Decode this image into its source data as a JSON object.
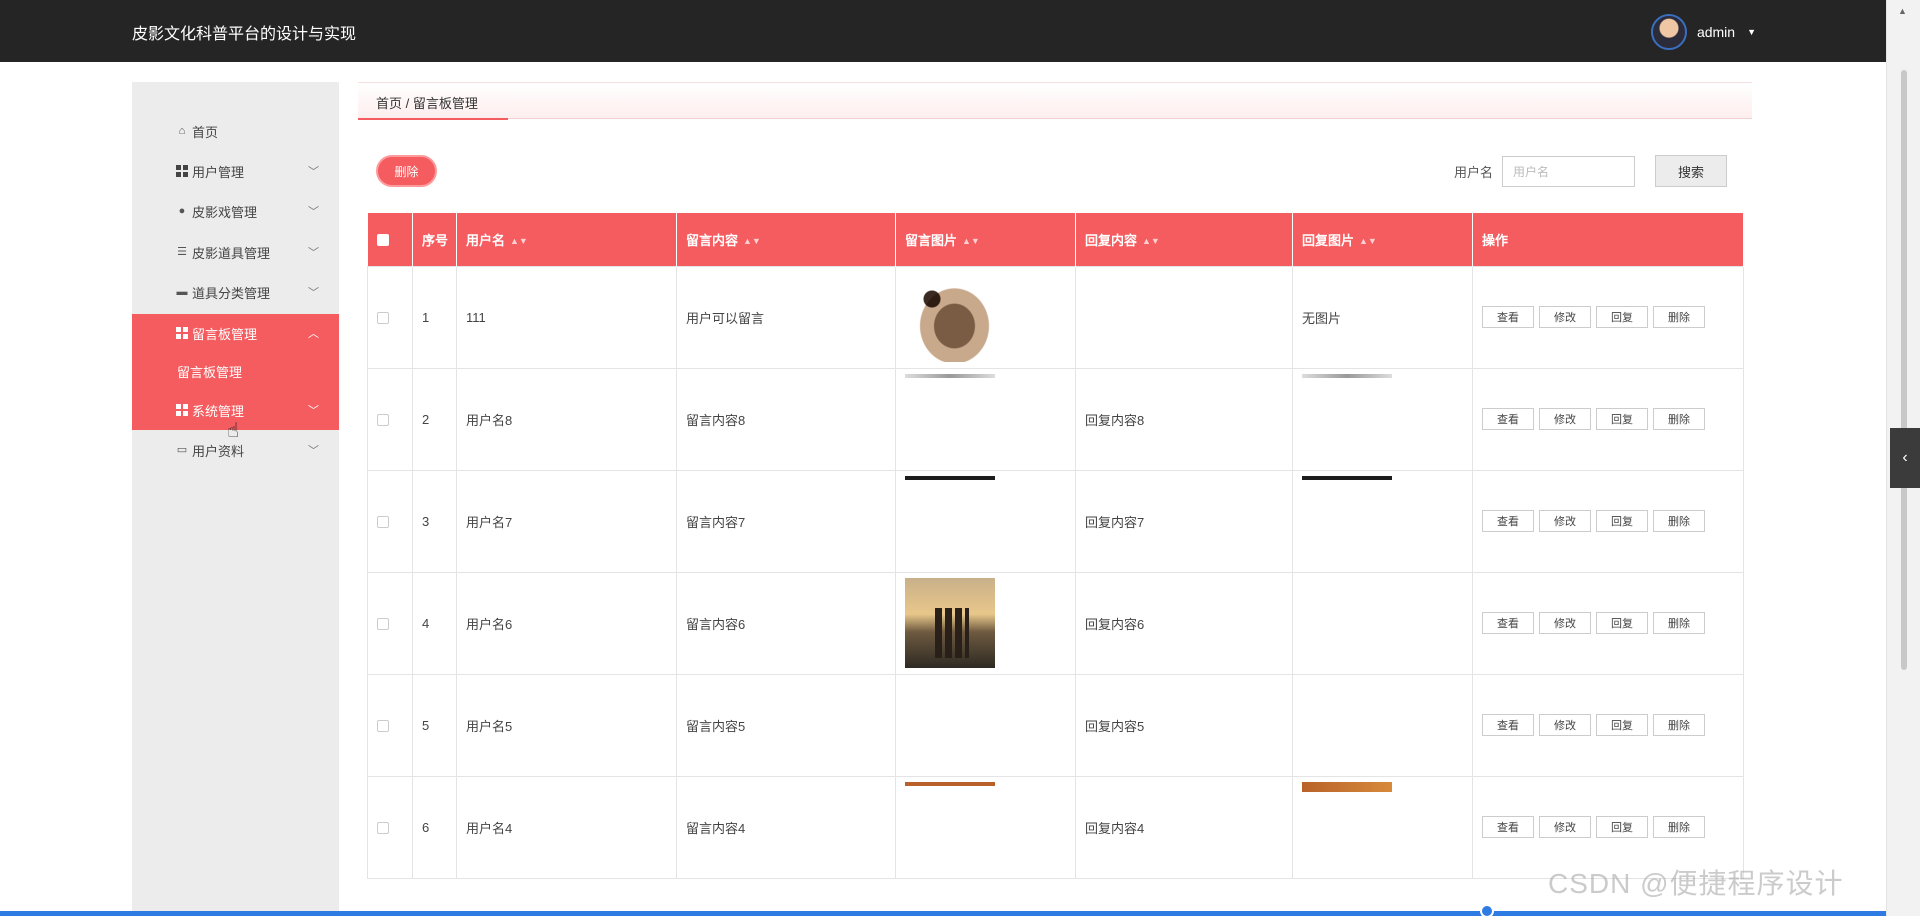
{
  "app": {
    "title": "皮影文化科普平台的设计与实现",
    "username": "admin"
  },
  "sidebar": {
    "items": [
      {
        "label": "首页",
        "icon": "home-icon"
      },
      {
        "label": "用户管理",
        "icon": "grid-icon"
      },
      {
        "label": "皮影戏管理",
        "icon": "user-icon"
      },
      {
        "label": "皮影道具管理",
        "icon": "list-icon"
      },
      {
        "label": "道具分类管理",
        "icon": "comment-icon"
      },
      {
        "label": "留言板管理",
        "icon": "grid-icon"
      },
      {
        "label": "系统管理",
        "icon": "grid-icon"
      },
      {
        "label": "用户资料",
        "icon": "card-icon"
      }
    ],
    "submenu": {
      "label": "留言板管理"
    }
  },
  "breadcrumb": {
    "text": "首页 / 留言板管理"
  },
  "toolbar": {
    "delete_label": "删除",
    "search_label": "用户名",
    "search_placeholder": "用户名",
    "search_button": "搜索"
  },
  "table": {
    "headers": [
      "序号",
      "用户名",
      "留言内容",
      "留言图片",
      "回复内容",
      "回复图片",
      "操作"
    ],
    "rows": [
      {
        "index": "1",
        "username": "111",
        "message": "用户可以留言",
        "reply": "",
        "reply_image_text": "无图片"
      },
      {
        "index": "2",
        "username": "用户名8",
        "message": "留言内容8",
        "reply": "回复内容8",
        "reply_image_text": ""
      },
      {
        "index": "3",
        "username": "用户名7",
        "message": "留言内容7",
        "reply": "回复内容7",
        "reply_image_text": ""
      },
      {
        "index": "4",
        "username": "用户名6",
        "message": "留言内容6",
        "reply": "回复内容6",
        "reply_image_text": ""
      },
      {
        "index": "5",
        "username": "用户名5",
        "message": "留言内容5",
        "reply": "回复内容5",
        "reply_image_text": ""
      },
      {
        "index": "6",
        "username": "用户名4",
        "message": "留言内容4",
        "reply": "回复内容4",
        "reply_image_text": ""
      }
    ],
    "actions": [
      "查看",
      "修改",
      "回复",
      "删除"
    ]
  },
  "watermark": "CSDN @便捷程序设计",
  "colors": {
    "accent": "#f45c5f",
    "topbar": "#252525",
    "sidebar": "#ececec"
  }
}
